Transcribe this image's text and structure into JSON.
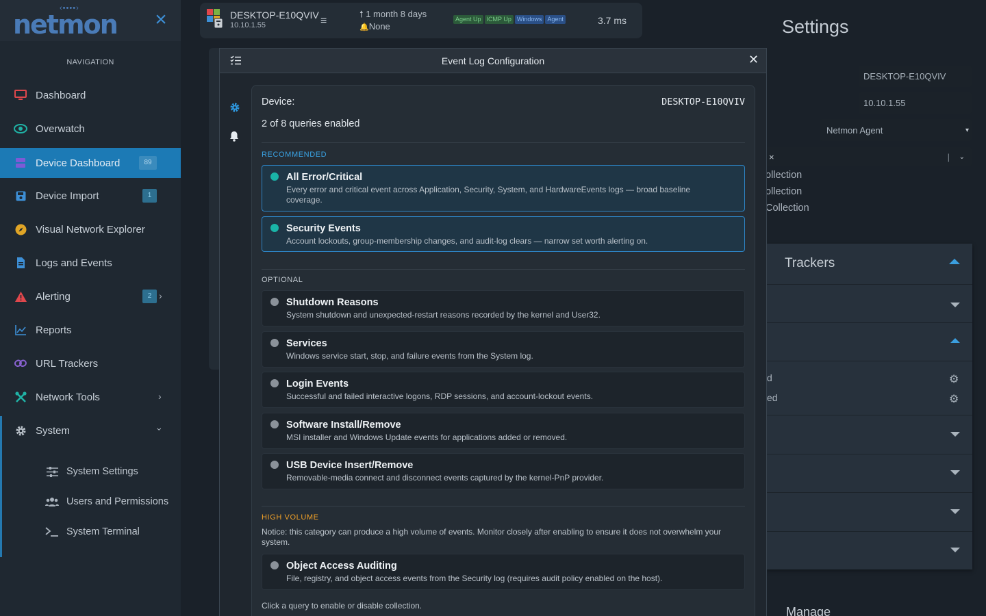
{
  "app": {
    "brand": "netmon"
  },
  "nav": {
    "heading": "NAVIGATION",
    "items": [
      {
        "label": "Dashboard",
        "icon": "monitor-icon",
        "color": "#e0474c"
      },
      {
        "label": "Overwatch",
        "icon": "eye-icon",
        "color": "#20b3a6"
      },
      {
        "label": "Device Dashboard",
        "icon": "server-icon",
        "color": "#7d5bd6",
        "badge": "89"
      },
      {
        "label": "Device Import",
        "icon": "save-icon",
        "color": "#3d8fd6",
        "badge": "1"
      },
      {
        "label": "Visual Network Explorer",
        "icon": "compass-icon",
        "color": "#e0a526"
      },
      {
        "label": "Logs and Events",
        "icon": "document-icon",
        "color": "#3d8fd6"
      },
      {
        "label": "Alerting",
        "icon": "warning-icon",
        "color": "#e0474c",
        "badge": "2"
      },
      {
        "label": "Reports",
        "icon": "line-chart-icon",
        "color": "#3d8fd6"
      },
      {
        "label": "URL Trackers",
        "icon": "link-icon",
        "color": "#8a63d2"
      },
      {
        "label": "Network Tools",
        "icon": "tools-icon",
        "color": "#20b3a6"
      },
      {
        "label": "System",
        "icon": "gear-icon",
        "color": "#b9c1c9"
      }
    ],
    "system_sub": [
      {
        "label": "System Settings",
        "icon": "sliders-icon"
      },
      {
        "label": "Users and Permissions",
        "icon": "users-icon"
      },
      {
        "label": "System Terminal",
        "icon": "terminal-icon"
      }
    ]
  },
  "device_bar": {
    "name": "DESKTOP-E10QVIV",
    "ip": "10.10.1.55",
    "uptime": "1 month 8 days",
    "alerts": "None",
    "tags": [
      "Agent Up",
      "ICMP Up",
      "Windows",
      "Agent"
    ],
    "latency": "3.7 ms"
  },
  "settings": {
    "title": "Settings",
    "hostname": "DESKTOP-E10QVIV",
    "ip": "10.10.1.55",
    "collector": "Netmon Agent",
    "collection_rows": [
      "ollection",
      "ollection",
      "Collection"
    ],
    "trackers_title": "Trackers",
    "tracker_rows": [
      "d",
      "ed"
    ],
    "manage_title": "Manage"
  },
  "modal": {
    "title": "Event Log Configuration",
    "device_label": "Device:",
    "device_value": "DESKTOP-E10QVIV",
    "enabled_count": "2 of 8 queries enabled",
    "sections": {
      "recommended": "RECOMMENDED",
      "optional": "OPTIONAL",
      "high_volume": "HIGH VOLUME"
    },
    "recommended": [
      {
        "name": "All Error/Critical",
        "desc": "Every error and critical event across Application, Security, System, and HardwareEvents logs — broad baseline coverage.",
        "enabled": true
      },
      {
        "name": "Security Events",
        "desc": "Account lockouts, group-membership changes, and audit-log clears — narrow set worth alerting on.",
        "enabled": true
      }
    ],
    "optional": [
      {
        "name": "Shutdown Reasons",
        "desc": "System shutdown and unexpected-restart reasons recorded by the kernel and User32.",
        "enabled": false
      },
      {
        "name": "Services",
        "desc": "Windows service start, stop, and failure events from the System log.",
        "enabled": false
      },
      {
        "name": "Login Events",
        "desc": "Successful and failed interactive logons, RDP sessions, and account-lockout events.",
        "enabled": false
      },
      {
        "name": "Software Install/Remove",
        "desc": "MSI installer and Windows Update events for applications added or removed.",
        "enabled": false
      },
      {
        "name": "USB Device Insert/Remove",
        "desc": "Removable-media connect and disconnect events captured by the kernel-PnP provider.",
        "enabled": false
      }
    ],
    "high_volume_notice": "Notice: this category can produce a high volume of events. Monitor closely after enabling to ensure it does not overwhelm your system.",
    "high_volume": [
      {
        "name": "Object Access Auditing",
        "desc": "File, registry, and object access events from the Security log (requires audit policy enabled on the host).",
        "enabled": false
      }
    ],
    "hint": "Click a query to enable or disable collection."
  }
}
